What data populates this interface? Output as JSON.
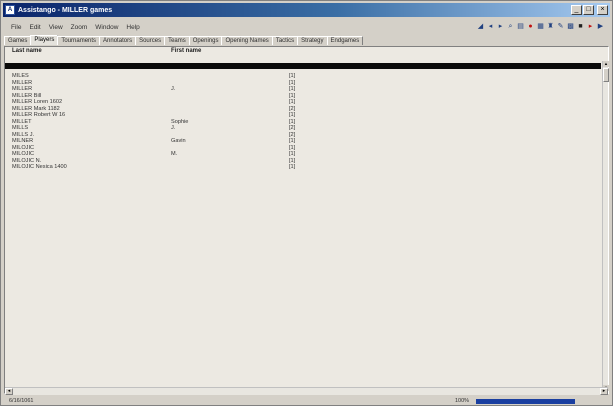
{
  "window": {
    "title": "Assistango - MILLER games",
    "icon_label": "A",
    "buttons": [
      "_",
      "□",
      "×"
    ]
  },
  "menu": [
    "File",
    "Edit",
    "View",
    "Zoom",
    "Window",
    "Help"
  ],
  "toolbar_icons": [
    "new-game-icon",
    "first-icon",
    "prev-icon",
    "search-icon",
    "filter-icon",
    "stop-icon",
    "database-icon",
    "tree-icon",
    "edit-icon",
    "save-icon",
    "print-icon",
    "next-icon",
    "last-icon"
  ],
  "tabs": [
    {
      "label": "Games",
      "active": false
    },
    {
      "label": "Players",
      "active": true
    },
    {
      "label": "Tournaments",
      "active": false
    },
    {
      "label": "Annotators",
      "active": false
    },
    {
      "label": "Sources",
      "active": false
    },
    {
      "label": "Teams",
      "active": false
    },
    {
      "label": "Openings",
      "active": false
    },
    {
      "label": "Opening Names",
      "active": false
    },
    {
      "label": "Tactics",
      "active": false
    },
    {
      "label": "Strategy",
      "active": false
    },
    {
      "label": "Endgames",
      "active": false
    }
  ],
  "table": {
    "columns": [
      "Last name",
      "First name",
      ""
    ],
    "rows": [
      {
        "last": "MILES",
        "first": "",
        "games": "[1]"
      },
      {
        "last": "MILLER",
        "first": "",
        "games": "[1]"
      },
      {
        "last": "MILLER",
        "first": "J.",
        "games": "[1]"
      },
      {
        "last": "MILLER Bill",
        "first": "",
        "games": "[1]"
      },
      {
        "last": "MILLER Loren 1602",
        "first": "",
        "games": "[1]"
      },
      {
        "last": "MILLER Mark 1182",
        "first": "",
        "games": "[2]"
      },
      {
        "last": "MILLER Robert W 16",
        "first": "",
        "games": "[1]"
      },
      {
        "last": "MILLET",
        "first": "Sophie",
        "games": "[1]"
      },
      {
        "last": "MILLS",
        "first": "J.",
        "games": "[2]"
      },
      {
        "last": "MILLS J.",
        "first": "",
        "games": "[2]"
      },
      {
        "last": "MILNER",
        "first": "Gavin",
        "games": "[1]"
      },
      {
        "last": "MILOJIC",
        "first": "",
        "games": "[1]"
      },
      {
        "last": "MILOJIC",
        "first": "M.",
        "games": "[1]"
      },
      {
        "last": "MILOJIC N.",
        "first": "",
        "games": "[1]"
      },
      {
        "last": "MILOJIC Nesica 1400",
        "first": "",
        "games": "[1]"
      }
    ]
  },
  "status": {
    "left": "6/16/1061",
    "percent_label": "100%",
    "progress": 0.8
  }
}
